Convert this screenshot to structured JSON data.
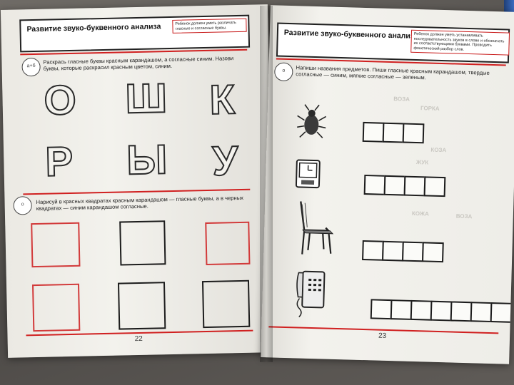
{
  "left_page": {
    "header_title": "Развитие звуко-буквенного анализа",
    "header_note": "Ребенок должен уметь различать гласные и согласные буквы.",
    "instruction_1": "Раскрась гласные буквы красным карандашом, а согласные синим. Назови буквы, которые раскрасил красным цветом, синим.",
    "letters": [
      "О",
      "Ш",
      "К",
      "Р",
      "Ы",
      "У"
    ],
    "instruction_2": "Нарисуй в красных квадратах красным карандашом — гласные буквы, а в черных квадратах — синим карандашом согласные.",
    "page_number": "22"
  },
  "right_page": {
    "header_title": "Развитие звуко-буквенного анализа",
    "header_note": "Ребенок должен уметь устанавливать последовательность звуков в слове и обозначать их соответствующими буквами. Проводить фонетический разбор слов.",
    "instruction": "Напиши названия предметов. Пиши гласные красным карандашом, твердые согласные — синим, мягкие согласные — зеленым.",
    "items": [
      {
        "name": "beetle-picture",
        "cells": 3
      },
      {
        "name": "clock-picture",
        "cells": 4
      },
      {
        "name": "chair-picture",
        "cells": 4
      },
      {
        "name": "telephone-picture",
        "cells": 7
      }
    ],
    "background_words": [
      "ВОЗА",
      "ГОРКА",
      "КОЗА",
      "ЖУК",
      "КОЖА",
      "ВОЗА"
    ],
    "page_number": "23"
  }
}
